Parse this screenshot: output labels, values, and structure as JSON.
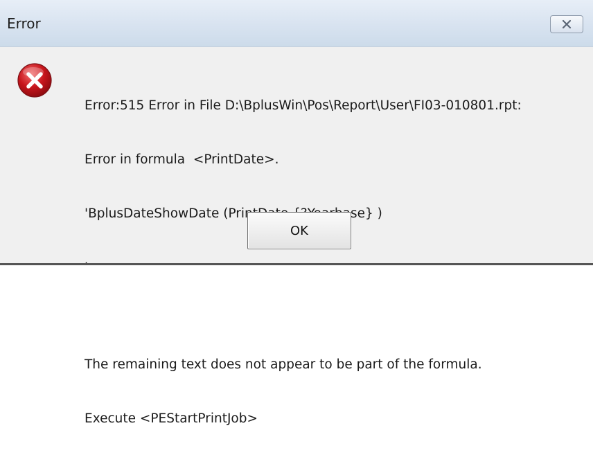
{
  "window": {
    "title": "Error",
    "close_icon": "close-icon"
  },
  "dialog": {
    "icon": "error-icon",
    "message_lines": [
      "Error:515 Error in File D:\\BplusWin\\Pos\\Report\\User\\FI03-010801.rpt:",
      "Error in formula  <PrintDate>.",
      "'BplusDateShowDate (PrintDate,{?Yearbase} )",
      "'",
      "The remaining text does not appear to be part of the formula.",
      "Execute <PEStartPrintJob>"
    ],
    "ok_label": "OK"
  },
  "colors": {
    "error_red": "#c8161d",
    "title_bar": "#d8e3f0",
    "dialog_bg": "#f0f0f0"
  }
}
